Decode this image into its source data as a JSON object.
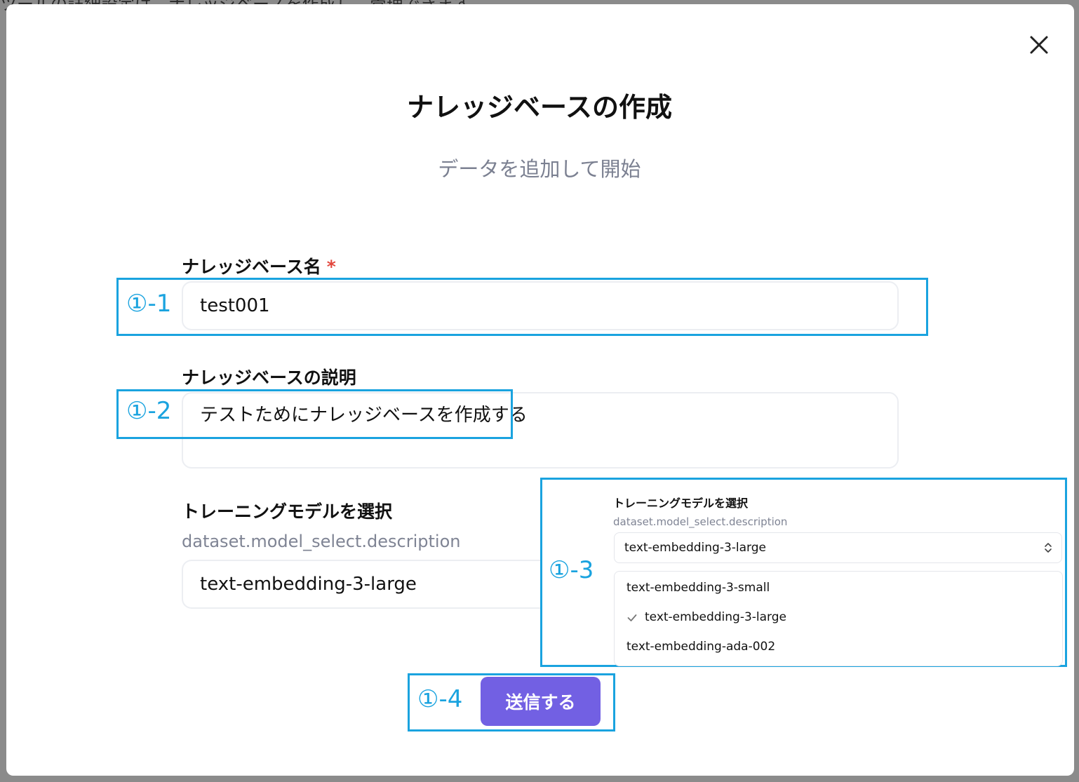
{
  "background_text": "ツールの詳細設定は、ナレッジベースを作成し、管理できます",
  "modal": {
    "title": "ナレッジベースの作成",
    "subtitle": "データを追加して開始"
  },
  "form": {
    "name_label": "ナレッジベース名",
    "required_mark": "*",
    "name_value": "test001",
    "description_label": "ナレッジベースの説明",
    "description_value": "テストためにナレッジベースを作成する",
    "model_label": "トレーニングモデルを選択",
    "model_description": "dataset.model_select.description",
    "model_value": "text-embedding-3-large",
    "submit_label": "送信する"
  },
  "dropdown": {
    "label": "トレーニングモデルを選択",
    "description": "dataset.model_select.description",
    "selected": "text-embedding-3-large",
    "options": [
      "text-embedding-3-small",
      "text-embedding-3-large",
      "text-embedding-ada-002"
    ]
  },
  "annotations": {
    "a1": "①-1",
    "a2": "①-2",
    "a3": "①-3",
    "a4": "①-4"
  },
  "colors": {
    "accent": "#7260e3",
    "annotation": "#1aa3df",
    "required": "#e2463c"
  }
}
